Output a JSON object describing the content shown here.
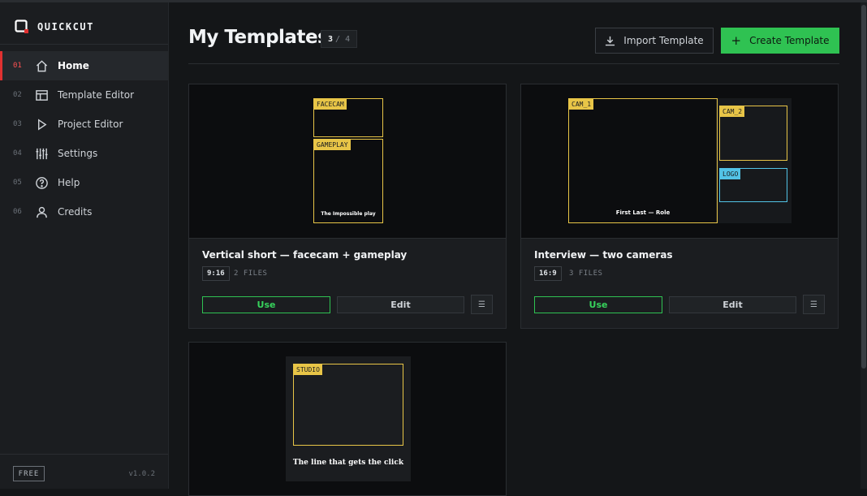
{
  "app": {
    "name": "QUICKCUT",
    "version": "v1.0.2",
    "plan": "FREE"
  },
  "nav": [
    {
      "num": "01",
      "label": "Home",
      "icon": "home-icon",
      "active": true
    },
    {
      "num": "02",
      "label": "Template Editor",
      "icon": "layout-icon"
    },
    {
      "num": "03",
      "label": "Project Editor",
      "icon": "play-icon"
    },
    {
      "num": "04",
      "label": "Settings",
      "icon": "sliders-icon"
    },
    {
      "num": "05",
      "label": "Help",
      "icon": "help-circle-icon"
    },
    {
      "num": "06",
      "label": "Credits",
      "icon": "user-icon"
    }
  ],
  "header": {
    "title": "My Templates",
    "count_current": "3",
    "count_total": "/ 4",
    "import_label": "Import Template",
    "create_label": "Create Template"
  },
  "colors": {
    "accent": "#2fc252",
    "active_marker": "#e03131",
    "slot": "#e8c547",
    "logo_slot": "#52c3e6"
  },
  "cards": [
    {
      "title": "Vertical short — facecam + gameplay",
      "ratio": "9:16",
      "files": "2 FILES",
      "use_label": "Use",
      "edit_label": "Edit",
      "menu_glyph": "☰",
      "slots": [
        "FACECAM",
        "GAMEPLAY"
      ],
      "caption": "The Impossible play"
    },
    {
      "title": "Interview — two cameras",
      "ratio": "16:9",
      "files": "3 FILES",
      "use_label": "Use",
      "edit_label": "Edit",
      "menu_glyph": "☰",
      "slots": [
        "CAM_1",
        "CAM_2",
        "LOGO"
      ],
      "caption": "First Last — Role"
    },
    {
      "slots": [
        "STUDIO"
      ],
      "caption": "The line that gets the click"
    }
  ]
}
